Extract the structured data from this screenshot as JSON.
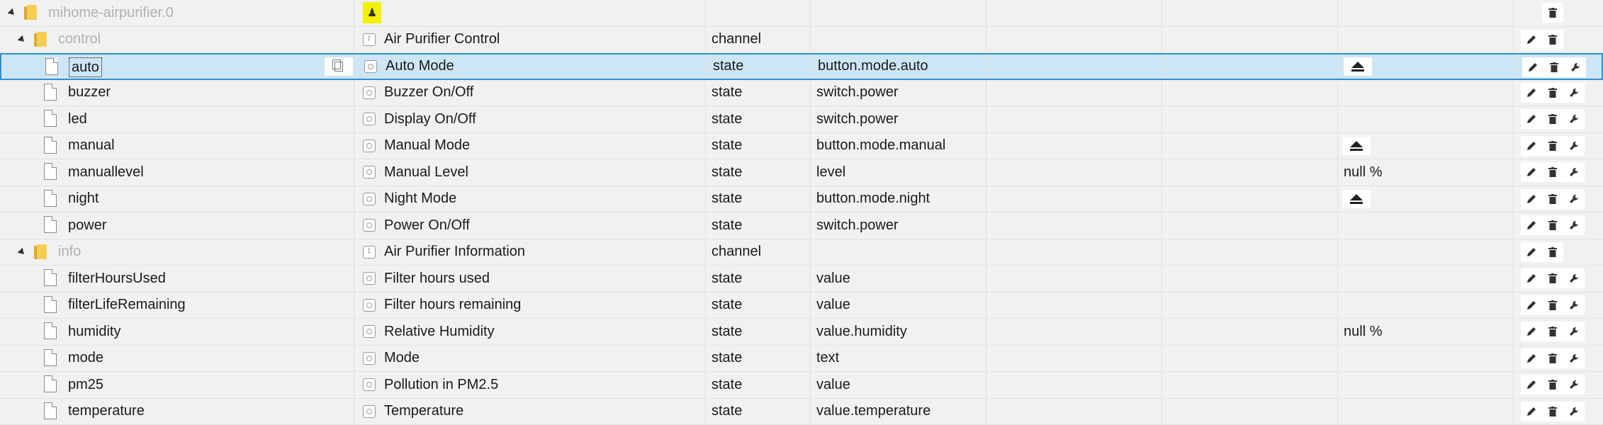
{
  "root": {
    "id": "mihome-airpurifier.0"
  },
  "groups": [
    {
      "id": "control",
      "name": "Air Purifier Control",
      "type": "channel",
      "children": [
        {
          "id": "auto",
          "name": "Auto Mode",
          "type": "state",
          "role": "button.mode.auto",
          "value_icon": "eject-icon",
          "selected": true
        },
        {
          "id": "buzzer",
          "name": "Buzzer On/Off",
          "type": "state",
          "role": "switch.power"
        },
        {
          "id": "led",
          "name": "Display On/Off",
          "type": "state",
          "role": "switch.power"
        },
        {
          "id": "manual",
          "name": "Manual Mode",
          "type": "state",
          "role": "button.mode.manual",
          "value_icon": "eject-icon"
        },
        {
          "id": "manuallevel",
          "name": "Manual Level",
          "type": "state",
          "role": "level",
          "value": "null %"
        },
        {
          "id": "night",
          "name": "Night Mode",
          "type": "state",
          "role": "button.mode.night",
          "value_icon": "eject-icon"
        },
        {
          "id": "power",
          "name": "Power On/Off",
          "type": "state",
          "role": "switch.power"
        }
      ]
    },
    {
      "id": "info",
      "name": "Air Purifier Information",
      "type": "channel",
      "children": [
        {
          "id": "filterHoursUsed",
          "name": "Filter hours used",
          "type": "state",
          "role": "value"
        },
        {
          "id": "filterLifeRemaining",
          "name": "Filter hours remaining",
          "type": "state",
          "role": "value"
        },
        {
          "id": "humidity",
          "name": "Relative Humidity",
          "type": "state",
          "role": "value.humidity",
          "value": "null %"
        },
        {
          "id": "mode",
          "name": "Mode",
          "type": "state",
          "role": "text"
        },
        {
          "id": "pm25",
          "name": "Pollution in PM2.5",
          "type": "state",
          "role": "value"
        },
        {
          "id": "temperature",
          "name": "Temperature",
          "type": "state",
          "role": "value.temperature"
        }
      ]
    }
  ],
  "colors": {
    "selected_bg": "#cde6f6",
    "selected_border": "#2f8fd1",
    "folder": "#f6cd54",
    "adapter_icon_bg": "#f4f000"
  }
}
